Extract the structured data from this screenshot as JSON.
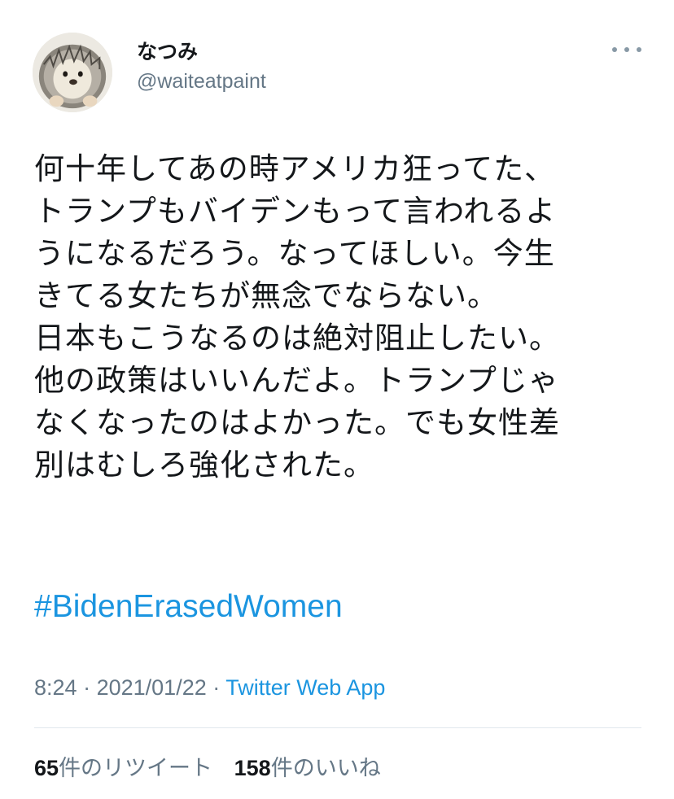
{
  "user": {
    "display_name": "なつみ",
    "handle": "@waiteatpaint"
  },
  "tweet": {
    "lines": [
      "何十年してあの時アメリカ狂ってた、",
      "トランプもバイデンもって言われるよ",
      "うになるだろう。なってほしい。今生",
      "きてる女たちが無念でならない。",
      "日本もこうなるのは絶対阻止したい。",
      "他の政策はいいんだよ。トランプじゃ",
      "なくなったのはよかった。でも女性差",
      "別はむしろ強化された。"
    ],
    "hashtag": "#BidenErasedWomen",
    "time": "8:24",
    "separator": "·",
    "date": "2021/01/22",
    "source": "Twitter Web App"
  },
  "stats": {
    "retweet_count": "65",
    "retweet_label": "件のリツイート",
    "like_count": "158",
    "like_label": "件のいいね"
  },
  "icons": {
    "more": "more-horizontal-icon",
    "avatar": "hedgehog-plush-avatar"
  },
  "colors": {
    "link": "#1b95e0",
    "secondary_text": "#657786",
    "primary_text": "#14171a",
    "divider": "#e1e8ed"
  }
}
